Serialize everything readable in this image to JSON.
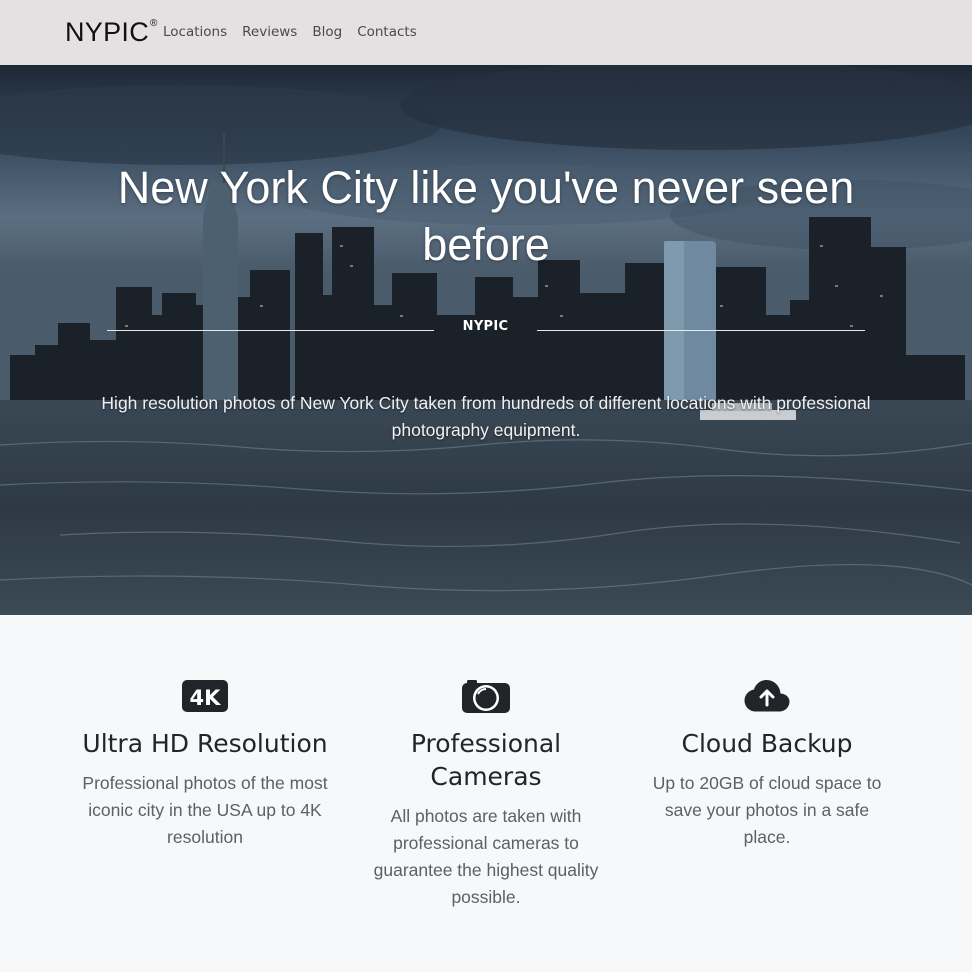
{
  "navbar": {
    "brand": "NYPIC",
    "brand_mark": "®",
    "links": [
      "Locations",
      "Reviews",
      "Blog",
      "Contacts"
    ]
  },
  "hero": {
    "title": "New York City like you've never seen before",
    "divider_label": "NYPIC",
    "subtitle": "High resolution photos of New York City taken from hundreds of different locations with professional photography equipment."
  },
  "features": [
    {
      "icon": "4k-icon",
      "icon_text": "4K",
      "title": "Ultra HD Resolution",
      "description": "Professional photos of the most iconic city in the USA up to 4K resolution"
    },
    {
      "icon": "camera-icon",
      "title": "Professional Cameras",
      "description": "All photos are taken with professional cameras to guarantee the highest quality possible."
    },
    {
      "icon": "cloud-upload-icon",
      "title": "Cloud Backup",
      "description": "Up to 20GB of cloud space to save your photos in a safe place."
    }
  ],
  "colors": {
    "navbar_bg": "#e5e1e2",
    "page_bg": "#f7f8fa",
    "heading": "#212529",
    "muted_text": "#5a6168"
  }
}
